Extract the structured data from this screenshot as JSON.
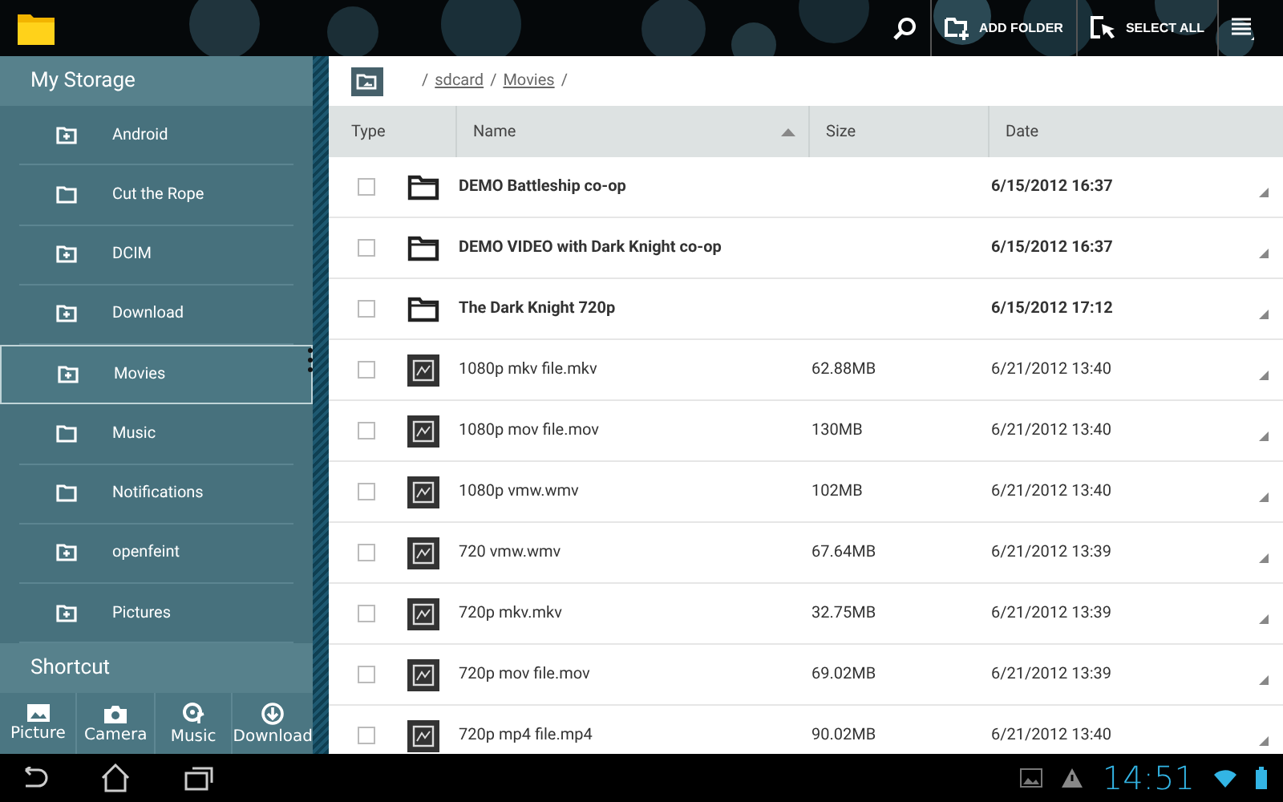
{
  "action_bar": {
    "actions": [
      {
        "kind": "search"
      },
      {
        "kind": "add_folder",
        "label": "ADD FOLDER"
      },
      {
        "kind": "select_all",
        "label": "SELECT ALL"
      },
      {
        "kind": "menu"
      }
    ]
  },
  "sidebar": {
    "title": "My Storage",
    "items": [
      {
        "label": "Android",
        "kind": "special",
        "selected": false
      },
      {
        "label": "Cut the Rope",
        "kind": "plain",
        "selected": false
      },
      {
        "label": "DCIM",
        "kind": "special",
        "selected": false
      },
      {
        "label": "Download",
        "kind": "special",
        "selected": false
      },
      {
        "label": "Movies",
        "kind": "special",
        "selected": true
      },
      {
        "label": "Music",
        "kind": "plain",
        "selected": false
      },
      {
        "label": "Notifications",
        "kind": "plain",
        "selected": false
      },
      {
        "label": "openfeint",
        "kind": "special",
        "selected": false
      },
      {
        "label": "Pictures",
        "kind": "special",
        "selected": false
      }
    ],
    "shortcut_title": "Shortcut",
    "shortcuts": [
      {
        "kind": "picture",
        "label": "Picture"
      },
      {
        "kind": "camera",
        "label": "Camera"
      },
      {
        "kind": "music",
        "label": "Music"
      },
      {
        "kind": "download",
        "label": "Download"
      }
    ]
  },
  "breadcrumb": [
    "/",
    "sdcard",
    "/",
    "Movies",
    "/"
  ],
  "table": {
    "columns": [
      "Type",
      "Name",
      "Size",
      "Date"
    ],
    "rows": [
      {
        "kind": "folder",
        "checked": false,
        "name": "DEMO Battleship co-op",
        "size": "",
        "date": "6/15/2012 16:37"
      },
      {
        "kind": "folder",
        "checked": false,
        "name": "DEMO VIDEO with Dark Knight co-op",
        "size": "",
        "date": "6/15/2012 16:37"
      },
      {
        "kind": "folder",
        "checked": false,
        "name": "The Dark Knight 720p",
        "size": "",
        "date": "6/15/2012 17:12"
      },
      {
        "kind": "video",
        "checked": false,
        "name": "1080p  mkv file.mkv",
        "size": "62.88MB",
        "date": "6/21/2012 13:40"
      },
      {
        "kind": "video",
        "checked": false,
        "name": "1080p mov file.mov",
        "size": "130MB",
        "date": "6/21/2012 13:40"
      },
      {
        "kind": "video",
        "checked": false,
        "name": "1080p vmw.wmv",
        "size": "102MB",
        "date": "6/21/2012 13:40"
      },
      {
        "kind": "video",
        "checked": false,
        "name": "720 vmw.wmv",
        "size": "67.64MB",
        "date": "6/21/2012 13:39"
      },
      {
        "kind": "video",
        "checked": false,
        "name": "720p mkv.mkv",
        "size": "32.75MB",
        "date": "6/21/2012 13:39"
      },
      {
        "kind": "video",
        "checked": false,
        "name": "720p mov file.mov",
        "size": "69.02MB",
        "date": "6/21/2012 13:39"
      },
      {
        "kind": "video",
        "checked": false,
        "name": "720p mp4 file.mp4",
        "size": "90.02MB",
        "date": "6/21/2012 13:40"
      }
    ]
  },
  "status_bar": {
    "time": "14:51"
  }
}
